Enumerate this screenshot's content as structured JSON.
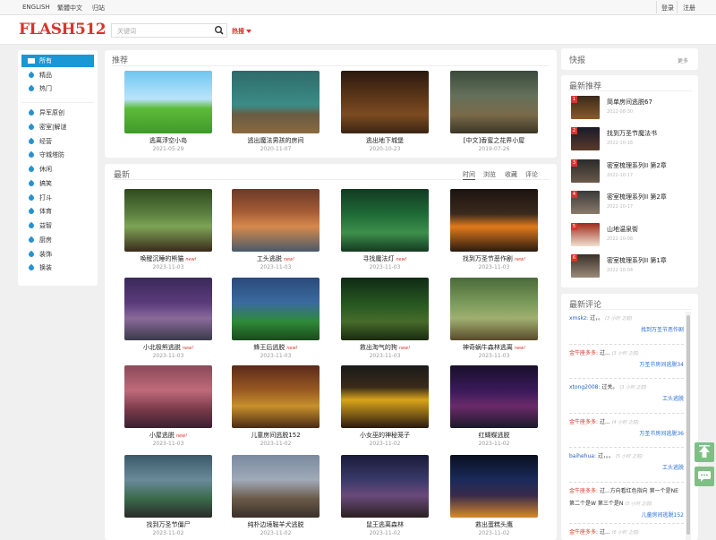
{
  "topbar": {
    "lang_en": "ENGLISH",
    "lang_tc": "繁體中文",
    "archive": "归站",
    "login": "登录",
    "register": "注册"
  },
  "header": {
    "logo": "FLASH512",
    "search_placeholder": "关键词",
    "hot_label": "热搜"
  },
  "sidebar": {
    "items": [
      {
        "label": "所有",
        "active": true
      },
      {
        "label": "精品"
      },
      {
        "label": "热门"
      },
      {
        "label": "异军原创"
      },
      {
        "label": "密室|解谜"
      },
      {
        "label": "经营"
      },
      {
        "label": "守城塔防"
      },
      {
        "label": "休闲"
      },
      {
        "label": "搞笑"
      },
      {
        "label": "打斗"
      },
      {
        "label": "体育"
      },
      {
        "label": "益智"
      },
      {
        "label": "厨房"
      },
      {
        "label": "装饰"
      },
      {
        "label": "换装"
      }
    ]
  },
  "recommend": {
    "title": "推荐",
    "cards": [
      {
        "title": "逃离浮空小岛",
        "date": "2021-05-29"
      },
      {
        "title": "逃出魔法男孩的房间",
        "date": "2020-11-07"
      },
      {
        "title": "逃出地下城堡",
        "date": "2020-10-23"
      },
      {
        "title": "[中文]香蜜之花界小屋",
        "date": "2019-07-26"
      }
    ]
  },
  "latest": {
    "title": "最新",
    "tabs": [
      "时间",
      "浏览",
      "收藏",
      "评论"
    ],
    "new_badge": "new!",
    "cards": [
      {
        "title": "唤醒沉睡的熊猫",
        "date": "2023-11-03",
        "new": true
      },
      {
        "title": "工头逃脱",
        "date": "2023-11-03",
        "new": true
      },
      {
        "title": "寻找魔法灯",
        "date": "2023-11-03",
        "new": true
      },
      {
        "title": "找到万圣节恶作剧",
        "date": "2023-11-03",
        "new": true
      },
      {
        "title": "小北极熊逃脱",
        "date": "2023-11-03",
        "new": true
      },
      {
        "title": "蜂王后逃脱",
        "date": "2023-11-03",
        "new": true
      },
      {
        "title": "救出淘气的狗",
        "date": "2023-11-03",
        "new": true
      },
      {
        "title": "神奇蜗牛森林逃离",
        "date": "2023-11-03",
        "new": true
      },
      {
        "title": "小屋逃脱",
        "date": "2023-11-03",
        "new": true
      },
      {
        "title": "儿童房间逃脱152",
        "date": "2023-11-02"
      },
      {
        "title": "小女巫的神秘笼子",
        "date": "2023-11-02"
      },
      {
        "title": "红蝴蝶逃脱",
        "date": "2023-11-02"
      },
      {
        "title": "找到万圣节僵尸",
        "date": "2023-11-02"
      },
      {
        "title": "纯朴边境鞍羊犬逃脱",
        "date": "2023-11-02"
      },
      {
        "title": "鼠王逃离森林",
        "date": "2023-11-02"
      },
      {
        "title": "救出蛋糕头鹰",
        "date": "2023-11-02"
      }
    ]
  },
  "quickfire": {
    "title": "快报",
    "more": "更多"
  },
  "recent": {
    "title": "最新推荐",
    "items": [
      {
        "rank": "1",
        "title": "简单房间逃脱67",
        "date": "2022-08-30"
      },
      {
        "rank": "2",
        "title": "找到万圣节魔法书",
        "date": "2022-10-18"
      },
      {
        "rank": "3",
        "title": "密室梳理系列II 第2章",
        "date": "2022-10-17"
      },
      {
        "rank": "4",
        "title": "密室梳理系列II 第2章",
        "date": "2022-10-17"
      },
      {
        "rank": "5",
        "title": "山地温泉街",
        "date": "2022-10-08"
      },
      {
        "rank": "6",
        "title": "密室梳理系列II 第1章",
        "date": "2022-10-04"
      }
    ]
  },
  "comments": {
    "title": "最新评论",
    "items": [
      {
        "user": "xmskz:",
        "text": "过，。",
        "time": "(3 小时 之前)",
        "game": "找到万圣节恶作剧"
      },
      {
        "user": "金牛座多多:",
        "text": "过...",
        "time": "(3 小时 之前)",
        "game": "万圣节房间逃脱34"
      },
      {
        "user": "xtong2008:",
        "text": "过关。",
        "time": "(3 小时 之前)",
        "game": "工头逃脱"
      },
      {
        "user": "金牛座多多:",
        "text": "过...",
        "time": "(4 小时 之前)",
        "game": "万圣节房间逃脱36"
      },
      {
        "user": "baihehua:",
        "text": "过，。。",
        "time": "(5 小时 之前)",
        "game": "工头逃脱"
      },
      {
        "user": "金牛座多多:",
        "text": "过...方向看红色指向 第一个是NE 第二个是W 第三个是N",
        "time": "(5 小时 之前)",
        "game": "儿童房间逃脱152"
      },
      {
        "user": "金牛座多多:",
        "text": "过...",
        "time": "(6 小时 之前)",
        "game": ""
      }
    ]
  },
  "colors": {
    "brand_red": "#d8352a",
    "active_blue": "#1998d5",
    "float_green": "#7fbf86"
  }
}
